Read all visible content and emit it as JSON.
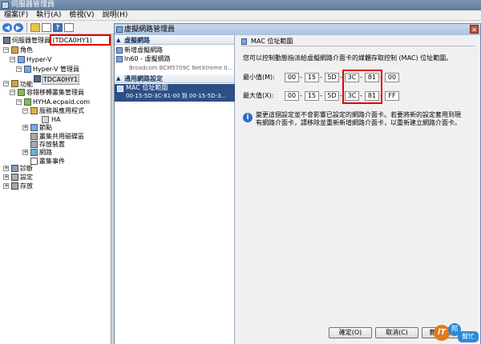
{
  "window_title": "伺服器管理員",
  "menu": [
    "檔案(F)",
    "執行(A)",
    "檢視(V)",
    "說明(H)"
  ],
  "tree": {
    "root": "伺服器管理員 (TDCA0HY1)",
    "roles": "角色",
    "hyperv": "Hyper-V",
    "hyperv_manager": "Hyper-V 管理員",
    "host": "TDCA0HY1",
    "features": "功能",
    "failover": "容錯移轉叢集管理員",
    "cluster": "HYHA.ecpaid.com",
    "services": "服務與應用程式",
    "ha": "HA",
    "nodes": "節點",
    "csv": "叢集共用磁碟區",
    "storage": "存放裝置",
    "networks": "網路",
    "events": "叢集事件",
    "diagnostics": "診斷",
    "config": "設定",
    "storage2": "存放"
  },
  "dialog": {
    "title": "虛擬網路管理員",
    "section1": "虛擬網路",
    "new_network": "新增虛擬網路",
    "ln60": "ln60 - 虛擬網路",
    "ln60_sub": "Broadcom BCM5709C NetXtreme II...",
    "section2": "通用網路設定",
    "mac_range": "MAC 位址範圍",
    "mac_range_sub": "00-15-5D-3C-81-00 到 00-15-5D-3...",
    "panel_title": "MAC 位址範圍",
    "desc": "您可以控制動態指派給虛擬網路介面卡的媒體存取控制 (MAC) 位址範圍。",
    "min_label": "最小值(M):",
    "max_label": "最大值(X):",
    "min_octets": [
      "00",
      "15",
      "5D",
      "3C",
      "81",
      "00"
    ],
    "max_octets": [
      "00",
      "15",
      "5D",
      "3C",
      "81",
      "FF"
    ],
    "info_line1": "變更這個設定並不會影響已設定的網路介面卡。若要將新的設定套用到現",
    "info_line2": "有網路介面卡，請移除並重新新增網路介面卡，以重新建立網路介面卡。",
    "ok": "確定(O)",
    "cancel": "取消(C)",
    "apply": "套用(A)"
  },
  "logo": {
    "text1": "iT",
    "text2": "邦",
    "text3": "幫忙"
  },
  "colors": {
    "selection": "#2d4f86",
    "highlight": "#e00000",
    "title_gradient": "#5f7c9c"
  }
}
